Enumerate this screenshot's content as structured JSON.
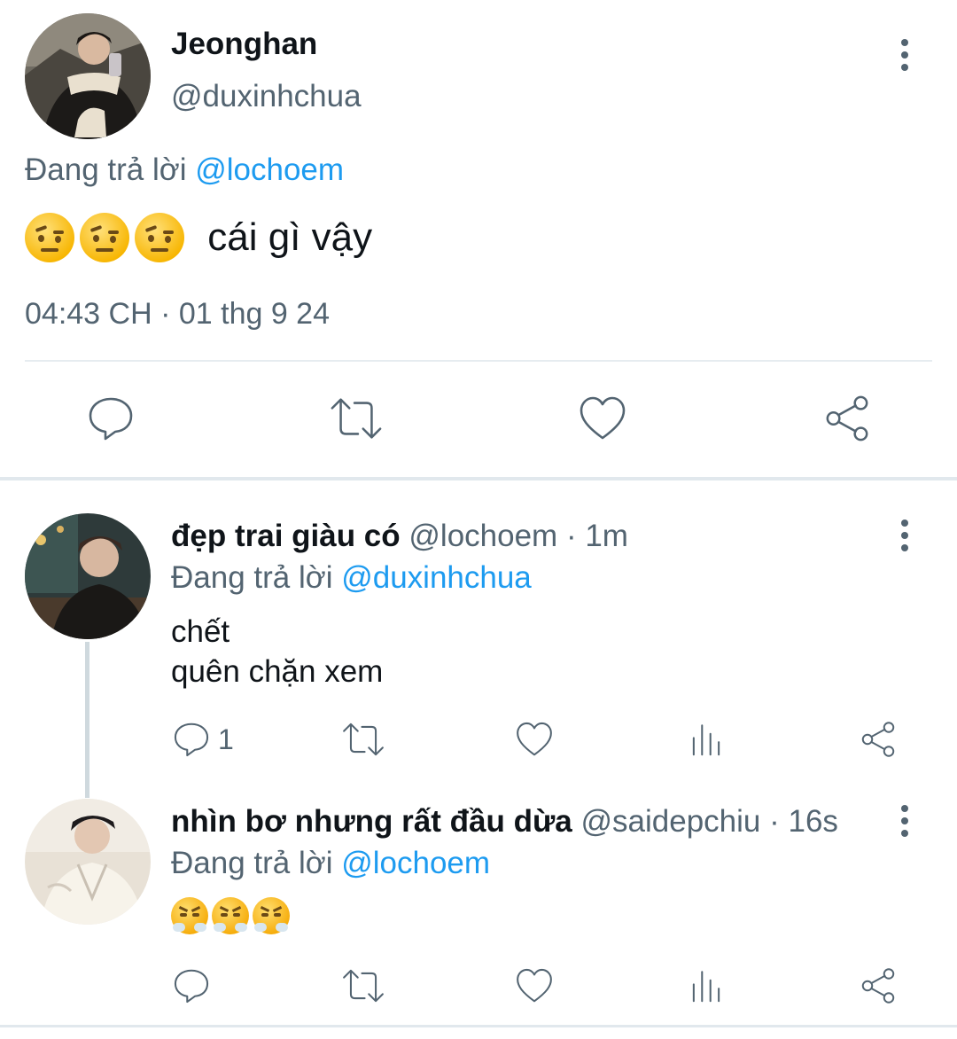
{
  "main_tweet": {
    "author_name": "Jeonghan",
    "handle": "@duxinhchua",
    "reply_prefix": "Đang trả lời",
    "reply_to": "@lochoem",
    "text": "cái gì vậy",
    "emoji_name": "face-with-raised-eyebrow",
    "timestamp": "04:43 CH · 01 thg 9 24"
  },
  "replies": [
    {
      "author_name": "đẹp trai giàu có",
      "handle": "@lochoem",
      "time": "· 1m",
      "reply_prefix": "Đang trả lời",
      "reply_to": "@duxinhchua",
      "text_line1": "chết",
      "text_line2": "quên chặn xem",
      "reply_count": "1"
    },
    {
      "author_name": "nhìn bơ nhưng rất đầu dừa",
      "handle": "@saidepchiu",
      "time": "· 16s",
      "reply_prefix": "Đang trả lời",
      "reply_to": "@lochoem",
      "emoji_name": "face-with-steam-from-nose",
      "reply_count": ""
    }
  ],
  "icons": {
    "reply": "speech-bubble",
    "retweet": "retweet-arrows",
    "like": "heart",
    "views": "bar-chart",
    "share": "share-nodes",
    "more": "vertical-ellipsis"
  },
  "colors": {
    "accent": "#1d9bf0",
    "muted_text": "#536471",
    "divider": "#e1e8ed"
  }
}
